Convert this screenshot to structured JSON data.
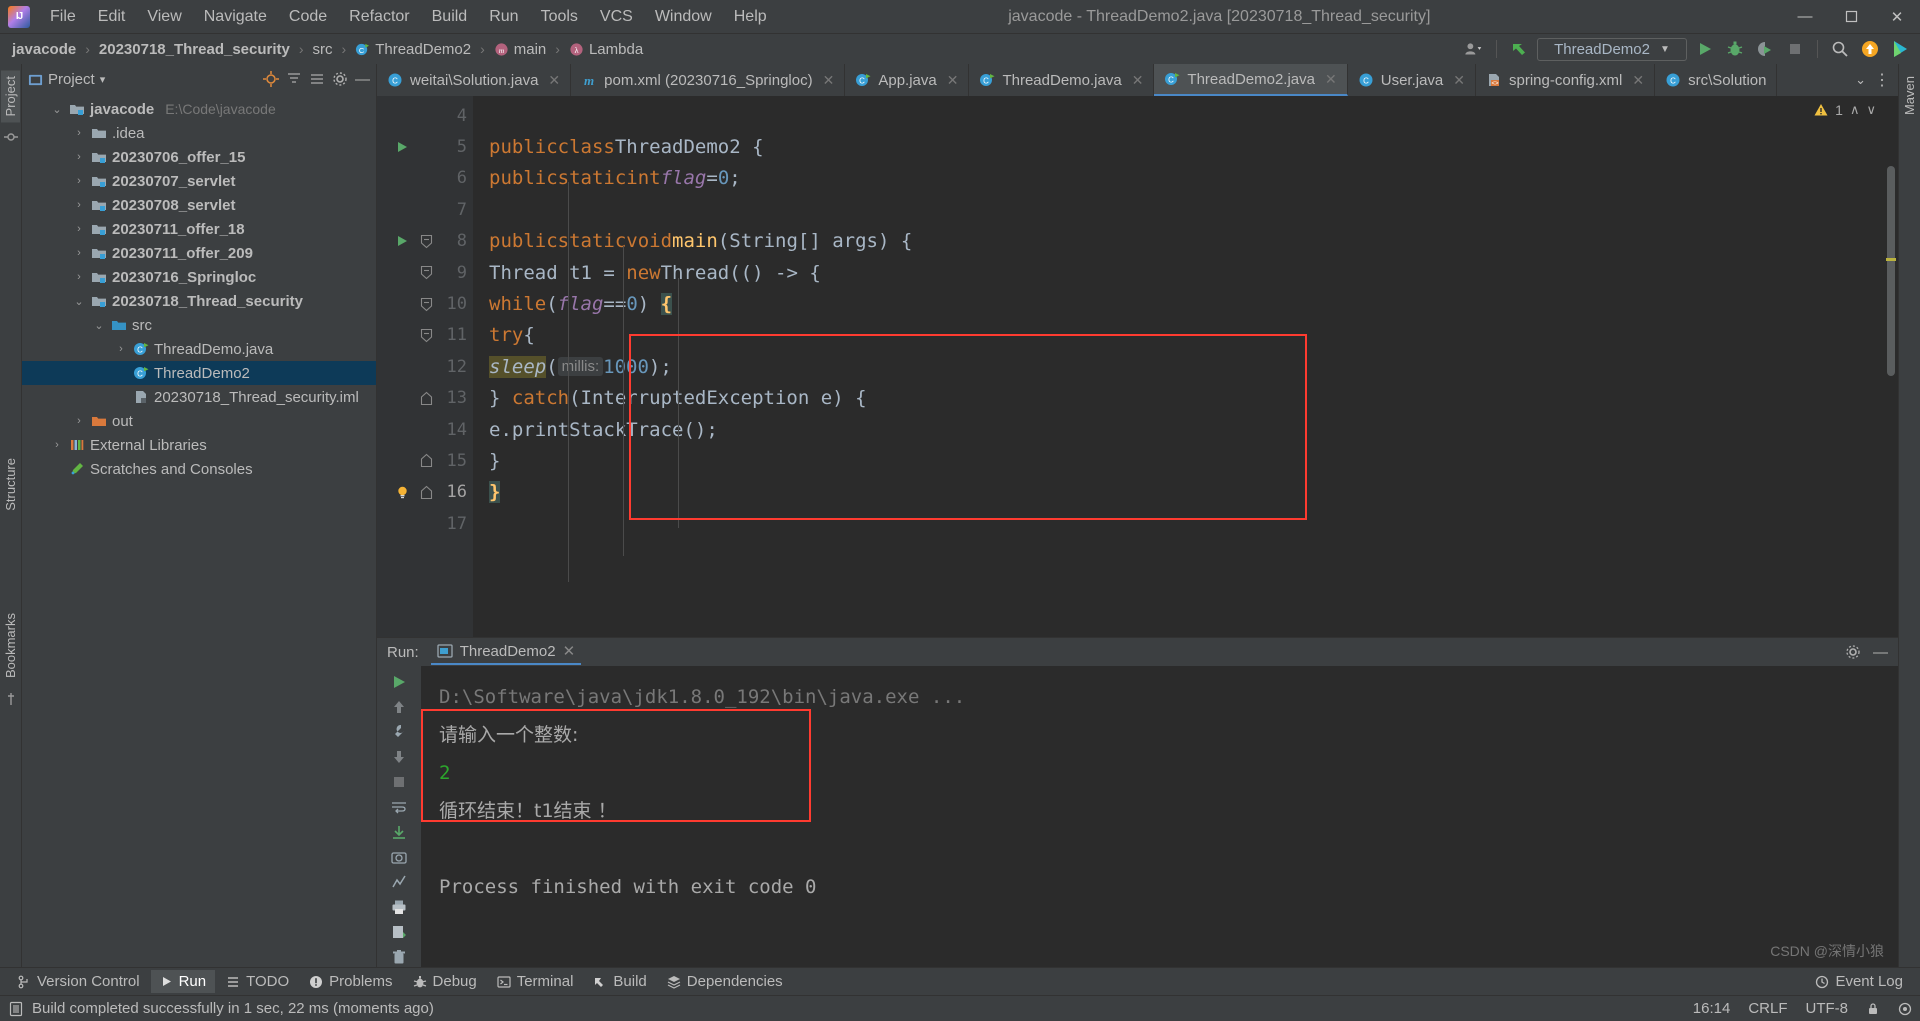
{
  "titlebar": {
    "window_title": "javacode - ThreadDemo2.java [20230718_Thread_security]",
    "logo_text": "IJ",
    "menu": [
      "File",
      "Edit",
      "View",
      "Navigate",
      "Code",
      "Refactor",
      "Build",
      "Run",
      "Tools",
      "VCS",
      "Window",
      "Help"
    ],
    "minimize": "—",
    "maximize": "❐",
    "close": "✕"
  },
  "navbar": {
    "breadcrumbs": [
      {
        "label": "javacode",
        "icon": ""
      },
      {
        "label": "20230718_Thread_security",
        "icon": ""
      },
      {
        "label": "src",
        "icon": ""
      },
      {
        "label": "ThreadDemo2",
        "icon": "class-icon"
      },
      {
        "label": "main",
        "icon": "method-icon"
      },
      {
        "label": "Lambda",
        "icon": "lambda-icon"
      }
    ],
    "separator": "›",
    "run_config": "ThreadDemo2",
    "run_config_caret": "▼",
    "icons": [
      "user-avatar-icon",
      "updates-arrow-icon",
      "run-icon",
      "debug-icon",
      "run-coverage-icon",
      "stop-icon",
      "search-icon",
      "notification-icon",
      "ide-assistant-icon"
    ]
  },
  "left_strip": {
    "tabs": [
      "Project",
      "Structure",
      "Bookmarks"
    ]
  },
  "right_strip": {
    "tabs": [
      "Maven"
    ]
  },
  "project": {
    "title": "Project",
    "title_caret": "▾",
    "tree": [
      {
        "indent": 0,
        "arrow": "⌄",
        "icon": "module-folder-icon",
        "name": "javacode",
        "bold": true,
        "path": "E:\\Code\\javacode",
        "selected": false
      },
      {
        "indent": 1,
        "arrow": "›",
        "icon": "folder-icon",
        "name": ".idea",
        "bold": false,
        "path": "",
        "selected": false
      },
      {
        "indent": 1,
        "arrow": "›",
        "icon": "module-folder-icon",
        "name": "20230706_offer_15",
        "bold": true,
        "path": "",
        "selected": false
      },
      {
        "indent": 1,
        "arrow": "›",
        "icon": "module-folder-icon",
        "name": "20230707_servlet",
        "bold": true,
        "path": "",
        "selected": false
      },
      {
        "indent": 1,
        "arrow": "›",
        "icon": "module-folder-icon",
        "name": "20230708_servlet",
        "bold": true,
        "path": "",
        "selected": false
      },
      {
        "indent": 1,
        "arrow": "›",
        "icon": "module-folder-icon",
        "name": "20230711_offer_18",
        "bold": true,
        "path": "",
        "selected": false
      },
      {
        "indent": 1,
        "arrow": "›",
        "icon": "module-folder-icon",
        "name": "20230711_offer_209",
        "bold": true,
        "path": "",
        "selected": false
      },
      {
        "indent": 1,
        "arrow": "›",
        "icon": "module-folder-icon",
        "name": "20230716_Springloc",
        "bold": true,
        "path": "",
        "selected": false
      },
      {
        "indent": 1,
        "arrow": "⌄",
        "icon": "module-folder-icon",
        "name": "20230718_Thread_security",
        "bold": true,
        "path": "",
        "selected": false
      },
      {
        "indent": 2,
        "arrow": "⌄",
        "icon": "source-folder-icon",
        "name": "src",
        "bold": false,
        "path": "",
        "selected": false
      },
      {
        "indent": 3,
        "arrow": "›",
        "icon": "java-class-icon",
        "name": "ThreadDemo.java",
        "bold": false,
        "path": "",
        "selected": false
      },
      {
        "indent": 3,
        "arrow": "",
        "icon": "java-class-icon",
        "name": "ThreadDemo2",
        "bold": false,
        "path": "",
        "selected": true
      },
      {
        "indent": 3,
        "arrow": "",
        "icon": "iml-file-icon",
        "name": "20230718_Thread_security.iml",
        "bold": false,
        "path": "",
        "selected": false
      },
      {
        "indent": 1,
        "arrow": "›",
        "icon": "out-folder-icon",
        "name": "out",
        "bold": false,
        "path": "",
        "selected": false
      },
      {
        "indent": 0,
        "arrow": "›",
        "icon": "libraries-icon",
        "name": "External Libraries",
        "bold": false,
        "path": "",
        "selected": false
      },
      {
        "indent": 0,
        "arrow": "",
        "icon": "scratches-icon",
        "name": "Scratches and Consoles",
        "bold": false,
        "path": "",
        "selected": false
      }
    ]
  },
  "editor": {
    "tabs": [
      {
        "label": "weitai\\Solution.java",
        "icon": "java-class-icon",
        "active": false
      },
      {
        "label": "pom.xml (20230716_Springloc)",
        "icon": "maven-icon",
        "active": false
      },
      {
        "label": "App.java",
        "icon": "java-class-icon",
        "active": false
      },
      {
        "label": "ThreadDemo.java",
        "icon": "java-class-icon",
        "active": false
      },
      {
        "label": "ThreadDemo2.java",
        "icon": "java-class-icon",
        "active": true
      },
      {
        "label": "User.java",
        "icon": "java-class-icon",
        "active": false
      },
      {
        "label": "spring-config.xml",
        "icon": "xml-file-icon",
        "active": false
      },
      {
        "label": "src\\Solution",
        "icon": "java-class-icon",
        "active": false
      }
    ],
    "tab_overflow": "⌄",
    "tab_more": "⋮",
    "close_glyph": "✕",
    "inspection": {
      "warning_count": "1",
      "warning_icon": "warning-triangle-icon",
      "up_arrow": "∧",
      "down_arrow": "∨"
    },
    "lines": [
      {
        "num": "4",
        "run": false,
        "fold": "",
        "code": ""
      },
      {
        "num": "5",
        "run": true,
        "fold": "",
        "code": "public class ThreadDemo2 {"
      },
      {
        "num": "6",
        "run": false,
        "fold": "",
        "code": "    public static int flag = 0;"
      },
      {
        "num": "7",
        "run": false,
        "fold": "",
        "code": ""
      },
      {
        "num": "8",
        "run": true,
        "fold": "down",
        "code": "    public static void main(String[] args) {"
      },
      {
        "num": "9",
        "run": false,
        "fold": "down",
        "code": "        Thread t1 = new Thread(() -> {"
      },
      {
        "num": "10",
        "run": false,
        "fold": "down",
        "code": "            while (flag == 0) {"
      },
      {
        "num": "11",
        "run": false,
        "fold": "down",
        "code": "                try {"
      },
      {
        "num": "12",
        "run": false,
        "fold": "",
        "code": "                    sleep( millis: 1000);"
      },
      {
        "num": "13",
        "run": false,
        "fold": "up",
        "code": "                } catch (InterruptedException e) {"
      },
      {
        "num": "14",
        "run": false,
        "fold": "",
        "code": "                    e.printStackTrace();"
      },
      {
        "num": "15",
        "run": false,
        "fold": "up",
        "code": "                }"
      },
      {
        "num": "16",
        "run": false,
        "fold": "up",
        "code": "            }",
        "bulb": true
      },
      {
        "num": "17",
        "run": false,
        "fold": "",
        "code": ""
      }
    ],
    "param_hint": "millis:"
  },
  "run_panel": {
    "label": "Run:",
    "tab_name": "ThreadDemo2",
    "tab_close": "✕",
    "settings_icon": "gear-icon",
    "minimize_icon": "—",
    "tools": [
      "rerun-icon",
      "wrench-icon",
      "stop-icon",
      "up-arrow-icon",
      "down-arrow-icon",
      "soft-wrap-icon",
      "scroll-to-end-icon",
      "camera-icon",
      "trace-icon",
      "print-icon",
      "export-icon",
      "trash-icon"
    ],
    "console": [
      {
        "text": "D:\\Software\\java\\jdk1.8.0_192\\bin\\java.exe ...",
        "color": "gray"
      },
      {
        "text": "请输入一个整数:",
        "color": "cn"
      },
      {
        "text": "2",
        "color": "green"
      },
      {
        "text": "循环结束！t1结束 ！",
        "color": "cn"
      },
      {
        "text": "",
        "color": "gray"
      },
      {
        "text": "Process finished with exit code 0",
        "color": "normal"
      }
    ]
  },
  "tool_window_bar": {
    "items": [
      {
        "label": "Version Control",
        "icon": "branch-icon",
        "selected": false
      },
      {
        "label": "Run",
        "icon": "run-icon",
        "selected": true
      },
      {
        "label": "TODO",
        "icon": "todo-icon",
        "selected": false
      },
      {
        "label": "Problems",
        "icon": "problems-icon",
        "selected": false
      },
      {
        "label": "Debug",
        "icon": "debug-icon",
        "selected": false
      },
      {
        "label": "Terminal",
        "icon": "terminal-icon",
        "selected": false
      },
      {
        "label": "Build",
        "icon": "build-icon",
        "selected": false
      },
      {
        "label": "Dependencies",
        "icon": "dependencies-icon",
        "selected": false
      }
    ],
    "event_log": "Event Log",
    "event_log_icon": "bell-icon"
  },
  "status_bar": {
    "message": "Build completed successfully in 1 sec, 22 ms (moments ago)",
    "message_icon": "build-status-icon",
    "time": "16:14",
    "line_separator": "CRLF",
    "encoding": "UTF-8"
  },
  "watermark": "CSDN @深情小狼",
  "colors": {
    "accent": "#4a88c7",
    "selection": "#0d3a58",
    "highlight_box": "#ff3b30",
    "keyword": "#cc7832",
    "field": "#9876aa",
    "number": "#6897bb",
    "method": "#ffc66d",
    "text": "#a9b7c6",
    "console_green": "#2ca72c",
    "editor_bg": "#2b2b2b",
    "chrome_bg": "#3c3f41"
  }
}
